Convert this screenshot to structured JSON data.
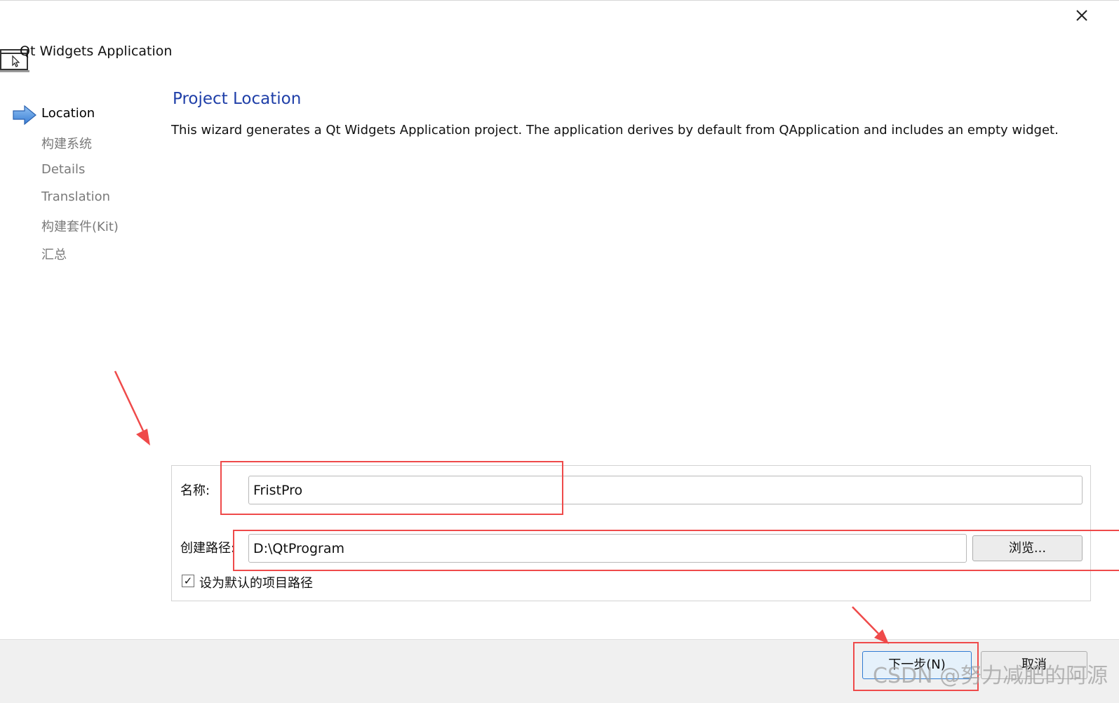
{
  "window": {
    "title": "Qt Widgets Application",
    "close_icon": "close-icon"
  },
  "steps": [
    {
      "label": "Location",
      "active": true
    },
    {
      "label": "构建系统",
      "active": false
    },
    {
      "label": "Details",
      "active": false
    },
    {
      "label": "Translation",
      "active": false
    },
    {
      "label": "构建套件(Kit)",
      "active": false
    },
    {
      "label": "汇总",
      "active": false
    }
  ],
  "page": {
    "title": "Project Location",
    "description": "This wizard generates a Qt Widgets Application project. The application derives by default from QApplication and includes an empty widget."
  },
  "form": {
    "name_label": "名称:",
    "name_value": "FristPro",
    "path_label": "创建路径:",
    "path_value": "D:\\QtProgram",
    "browse_label": "浏览...",
    "default_path_checked": true,
    "default_path_label": "设为默认的项目路径"
  },
  "footer": {
    "next_label": "下一步(N)",
    "cancel_label": "取消"
  },
  "watermark": "CSDN @努力减肥的阿源",
  "colors": {
    "accent": "#1f3fa8",
    "highlight": "#ef4a4a",
    "arrow_step": "#4a8ee0"
  }
}
